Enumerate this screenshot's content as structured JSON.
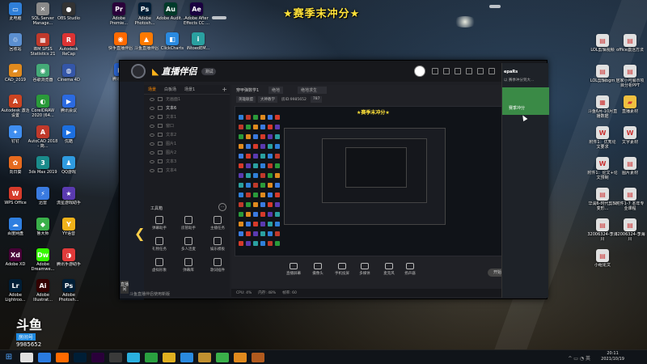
{
  "banner": "★赛季末冲分★",
  "desktop": {
    "left_icons": [
      {
        "label": "此电脑",
        "color": "#2f7fd8",
        "glyph": "▭"
      },
      {
        "label": "SQL Server Manage...",
        "color": "#8a8a8a",
        "glyph": "✕"
      },
      {
        "label": "OBS Studio",
        "color": "#333333",
        "glyph": "●"
      },
      {
        "label": "回收站",
        "color": "#5b8fd0",
        "glyph": "♲"
      },
      {
        "label": "IBM SPSS Statistics 21",
        "color": "#c0392b",
        "glyph": "▦"
      },
      {
        "label": "Autodesk ReCap",
        "color": "#d33",
        "glyph": "R"
      },
      {
        "label": "CAD_2019",
        "color": "#e08a1e",
        "glyph": "▰"
      },
      {
        "label": "谷歌浏览器",
        "color": "#4a7",
        "glyph": "◉"
      },
      {
        "label": "Cinema 4D",
        "color": "#3456a8",
        "glyph": "◍"
      },
      {
        "label": "Autodesk 激活设置",
        "color": "#c42",
        "glyph": "A"
      },
      {
        "label": "CorelDRAW 2020 (64...",
        "color": "#2a9a3a",
        "glyph": "◐"
      },
      {
        "label": "腾讯会议",
        "color": "#2b6ae0",
        "glyph": "▶"
      },
      {
        "label": "钉钉",
        "color": "#3f8ef0",
        "glyph": "✦"
      },
      {
        "label": "AutoCAD 2018 - 简...",
        "color": "#c0392b",
        "glyph": "A"
      },
      {
        "label": "优酷",
        "color": "#1c6fe0",
        "glyph": "▶"
      },
      {
        "label": "向日葵",
        "color": "#e66a1e",
        "glyph": "✿"
      },
      {
        "label": "3ds Max 2019",
        "color": "#1a8b8b",
        "glyph": "3"
      },
      {
        "label": "QQ游戏",
        "color": "#2f9be0",
        "glyph": "♟"
      },
      {
        "label": "WPS Office",
        "color": "#d63a2a",
        "glyph": "W"
      },
      {
        "label": "迅雷",
        "color": "#3a7be0",
        "glyph": "⚡"
      },
      {
        "label": "流星游戏助手",
        "color": "#5a3ab0",
        "glyph": "★"
      },
      {
        "label": "百度网盘",
        "color": "#2f7fe0",
        "glyph": "☁"
      },
      {
        "label": "鲁大师",
        "color": "#3ab04a",
        "glyph": "◆"
      },
      {
        "label": "YY语音",
        "color": "#f0b21a",
        "glyph": "Y"
      },
      {
        "label": "Adobe XD",
        "color": "#470137",
        "glyph": "Xd"
      },
      {
        "label": "Adobe Dreamwe...",
        "color": "#35fa00",
        "glyph": "Dw"
      },
      {
        "label": "腾讯手游助手",
        "color": "#e03a3a",
        "glyph": "◑"
      },
      {
        "label": "Adobe Lightroo...",
        "color": "#001e36",
        "glyph": "Lr"
      },
      {
        "label": "Adobe Illustrat...",
        "color": "#330000",
        "glyph": "Ai"
      },
      {
        "label": "Adobe Photosh...",
        "color": "#001e36",
        "glyph": "Ps"
      },
      {
        "label": "Adobe Premie...",
        "color": "#2a003a",
        "glyph": "Pr"
      },
      {
        "label": "Adobe Photosh...",
        "color": "#001e36",
        "glyph": "Ps"
      },
      {
        "label": "Adobe Audit...",
        "color": "#003a2a",
        "glyph": "Au"
      },
      {
        "label": "Adobe After Effects CC ...",
        "color": "#1a0040",
        "glyph": "Ae"
      },
      {
        "label": "快手直播伴侣",
        "color": "#ff6a00",
        "glyph": "◉"
      },
      {
        "label": "斗鱼直播伴侣",
        "color": "#ff7a00",
        "glyph": "▲"
      },
      {
        "label": "ClickCharts",
        "color": "#2a8ae0",
        "glyph": "◧"
      },
      {
        "label": "iNtoedEM...",
        "color": "#2aa0a0",
        "glyph": "i"
      },
      {
        "label": "腾讯会议",
        "color": "#2b6ae0",
        "glyph": "▶"
      }
    ],
    "right_icons": [
      {
        "label": "LOL剪辑视频",
        "color": "#e0e0e0",
        "glyph": "▤"
      },
      {
        "label": "office激活方法",
        "color": "#e0e0e0",
        "glyph": "▤"
      },
      {
        "label": "LOL剪辑bgm",
        "color": "#e0e0e0",
        "glyph": "▤"
      },
      {
        "label": "居家小可展示项目分析PPT",
        "color": "#e0e0e0",
        "glyph": "▤"
      },
      {
        "label": "斗鱼6月-10月直播数据",
        "color": "#e0e0e0",
        "glyph": "▦"
      },
      {
        "label": "直播素材",
        "color": "#f0c040",
        "glyph": "▰"
      },
      {
        "label": "附件1：优秀论文要求",
        "color": "#e0e0e0",
        "glyph": "W"
      },
      {
        "label": "文字素材",
        "color": "#e0e0e0",
        "glyph": "W"
      },
      {
        "label": "附件1：论文+论文预制",
        "color": "#e0e0e0",
        "glyph": "W"
      },
      {
        "label": "图片素材",
        "color": "#e0e0e0",
        "glyph": "▤"
      },
      {
        "label": "华润6-时代剪辑变形...",
        "color": "#e0e0e0",
        "glyph": "▤"
      },
      {
        "label": "附件1-7 本年专业课程",
        "color": "#e0e0e0",
        "glyph": "▤"
      },
      {
        "label": "32006324-李海川",
        "color": "#e0e0e0",
        "glyph": "▤"
      },
      {
        "label": "32006324-李海川",
        "color": "#e0e0e0",
        "glyph": "▤"
      },
      {
        "label": "小组论文",
        "color": "#e0e0e0",
        "glyph": "▤"
      }
    ]
  },
  "app": {
    "logo": "直播伴侣",
    "version": "测试",
    "scene_tabs": [
      "场景",
      "白板场",
      "场景1"
    ],
    "sources": [
      "文本6",
      "文本1",
      "窗口",
      "文本2",
      "图片1",
      "图片2",
      "文本3",
      "文本4"
    ],
    "source_hidden_label": "无画面1",
    "toolbox_title": "工具箱",
    "tools": [
      {
        "label": "弹幕助手"
      },
      {
        "label": "房管助手"
      },
      {
        "label": "主播任务"
      },
      {
        "label": "礼物任务"
      },
      {
        "label": "多人连麦"
      },
      {
        "label": "娱乐模板"
      },
      {
        "label": "虚拟形象"
      },
      {
        "label": "弹幕库"
      },
      {
        "label": "歌词插件"
      }
    ],
    "room": {
      "title": "穿甲弹数学1",
      "category": "绝地",
      "game": "绝地求生",
      "tags": [
        "英雄联盟",
        "大神教学"
      ],
      "room_id": "房ID:9985652",
      "views": "787"
    },
    "preview_banner": "★赛季末冲分★",
    "controls": [
      {
        "label": "直播屏幕"
      },
      {
        "label": "摄像头"
      },
      {
        "label": "手机投屏"
      },
      {
        "label": "多媒体"
      },
      {
        "label": "麦克风"
      },
      {
        "label": "扬声器"
      }
    ],
    "start_label": "开始直播",
    "status": [
      "CPU: 4%",
      "内存: 48%",
      "帧率: 60"
    ],
    "status_text": "斗鱼直播伴侣使用新版"
  },
  "chat": {
    "head": "epaRs",
    "sub": "以 赛季冲分到大...",
    "mid": "赛季冲分"
  },
  "watermark": {
    "logo": "斗鱼",
    "name": "房间号",
    "number": "9985652"
  },
  "taskbar": {
    "time": "20:11",
    "date": "2021/10/19",
    "apps": [
      "#e0e0e0",
      "#2a7be0",
      "#ff6a00",
      "#001e36",
      "#2a003a",
      "#3a3a3a",
      "#2ab0e0",
      "#2aa040",
      "#e0b020",
      "#2a8ae0",
      "#c09030",
      "#3ab04a",
      "#e08a1e",
      "#b05a1e"
    ]
  }
}
